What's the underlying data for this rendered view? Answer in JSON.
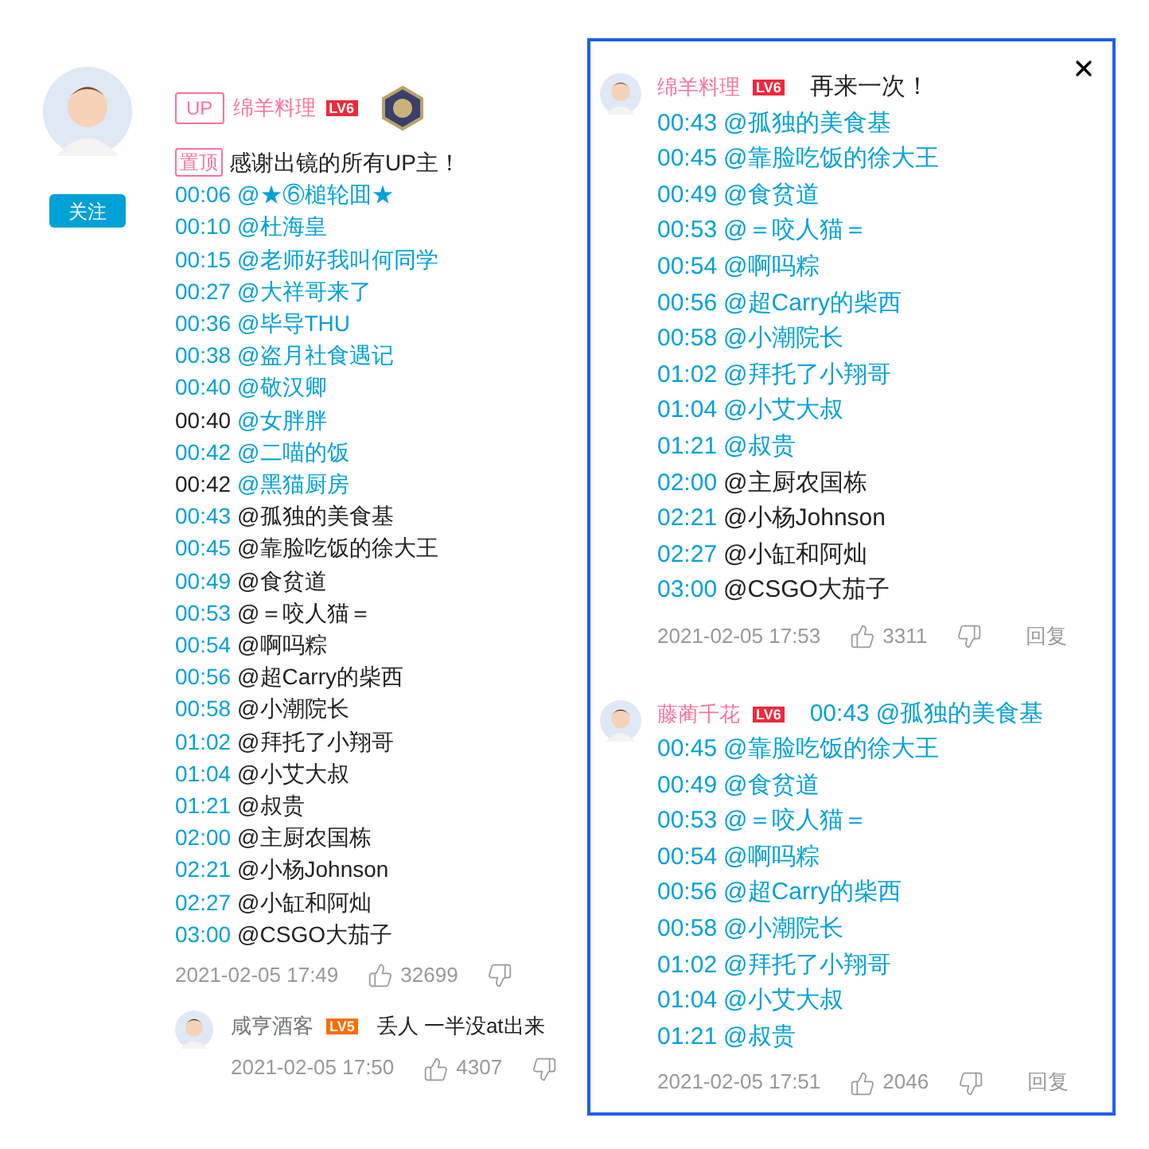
{
  "left_thread": {
    "follow_button": "关注",
    "comment": {
      "up_badge": "UP",
      "user": "绵羊料理",
      "level": {
        "label": "LV6",
        "color": "#f0283c"
      },
      "pinned_badge": "置顶",
      "text": "感谢出镜的所有UP主！",
      "lines": [
        {
          "time": "00:06",
          "mention": "@★⑥槌轮囬★",
          "time_link": true,
          "mention_link": true
        },
        {
          "time": "00:10",
          "mention": "@杜海皇",
          "time_link": true,
          "mention_link": true
        },
        {
          "time": "00:15",
          "mention": "@老师好我叫何同学",
          "time_link": true,
          "mention_link": true
        },
        {
          "time": "00:27",
          "mention": "@大祥哥来了",
          "time_link": true,
          "mention_link": true
        },
        {
          "time": "00:36",
          "mention": "@毕导THU",
          "time_link": true,
          "mention_link": true
        },
        {
          "time": "00:38",
          "mention": "@盗月社食遇记",
          "time_link": true,
          "mention_link": true
        },
        {
          "time": "00:40",
          "mention": "@敬汉卿",
          "time_link": true,
          "mention_link": true
        },
        {
          "time": "00:40",
          "mention": "@女胖胖",
          "time_link": false,
          "mention_link": true
        },
        {
          "time": "00:42",
          "mention": "@二喵的饭",
          "time_link": true,
          "mention_link": true
        },
        {
          "time": "00:42",
          "mention": "@黑猫厨房",
          "time_link": false,
          "mention_link": true
        },
        {
          "time": "00:43",
          "mention": "@孤独的美食基",
          "time_link": true,
          "mention_link": false
        },
        {
          "time": "00:45",
          "mention": "@靠脸吃饭的徐大王",
          "time_link": true,
          "mention_link": false
        },
        {
          "time": "00:49",
          "mention": "@食贫道",
          "time_link": true,
          "mention_link": false
        },
        {
          "time": "00:53",
          "mention": "@＝咬人猫＝",
          "time_link": true,
          "mention_link": false
        },
        {
          "time": "00:54",
          "mention": "@啊吗粽",
          "time_link": true,
          "mention_link": false
        },
        {
          "time": "00:56",
          "mention": "@超Carry的柴西",
          "time_link": true,
          "mention_link": false
        },
        {
          "time": "00:58",
          "mention": "@小潮院长",
          "time_link": true,
          "mention_link": false
        },
        {
          "time": "01:02",
          "mention": "@拜托了小翔哥",
          "time_link": true,
          "mention_link": false
        },
        {
          "time": "01:04",
          "mention": "@小艾大叔",
          "time_link": true,
          "mention_link": false
        },
        {
          "time": "01:21",
          "mention": "@叔贵",
          "time_link": true,
          "mention_link": false
        },
        {
          "time": "02:00",
          "mention": "@主厨农国栋",
          "time_link": true,
          "mention_link": false
        },
        {
          "time": "02:21",
          "mention": "@小杨Johnson",
          "time_link": true,
          "mention_link": false
        },
        {
          "time": "02:27",
          "mention": "@小缸和阿灿",
          "time_link": true,
          "mention_link": false
        },
        {
          "time": "03:00",
          "mention": "@CSGO大茄子",
          "time_link": true,
          "mention_link": false
        }
      ],
      "date": "2021-02-05 17:49",
      "likes": "32699"
    },
    "reply": {
      "user": "咸亨酒客",
      "level": {
        "label": "LV5",
        "color": "#ff6c00"
      },
      "text": "丢人 一半没at出来",
      "date": "2021-02-05 17:50",
      "likes": "4307"
    }
  },
  "dialog": {
    "comments": [
      {
        "user": "绵羊料理",
        "level": {
          "label": "LV6",
          "color": "#f0283c"
        },
        "text": "再来一次！",
        "lines": [
          {
            "time": "00:43",
            "mention": "@孤独的美食基",
            "time_link": true,
            "mention_link": true
          },
          {
            "time": "00:45",
            "mention": "@靠脸吃饭的徐大王",
            "time_link": true,
            "mention_link": true
          },
          {
            "time": "00:49",
            "mention": "@食贫道",
            "time_link": true,
            "mention_link": true
          },
          {
            "time": "00:53",
            "mention": "@＝咬人猫＝",
            "time_link": true,
            "mention_link": true
          },
          {
            "time": "00:54",
            "mention": "@啊吗粽",
            "time_link": true,
            "mention_link": true
          },
          {
            "time": "00:56",
            "mention": "@超Carry的柴西",
            "time_link": true,
            "mention_link": true
          },
          {
            "time": "00:58",
            "mention": "@小潮院长",
            "time_link": true,
            "mention_link": true
          },
          {
            "time": "01:02",
            "mention": "@拜托了小翔哥",
            "time_link": true,
            "mention_link": true
          },
          {
            "time": "01:04",
            "mention": "@小艾大叔",
            "time_link": true,
            "mention_link": true
          },
          {
            "time": "01:21",
            "mention": "@叔贵",
            "time_link": true,
            "mention_link": true
          },
          {
            "time": "02:00",
            "mention": "@主厨农国栋",
            "time_link": true,
            "mention_link": false
          },
          {
            "time": "02:21",
            "mention": "@小杨Johnson",
            "time_link": true,
            "mention_link": false
          },
          {
            "time": "02:27",
            "mention": "@小缸和阿灿",
            "time_link": true,
            "mention_link": false
          },
          {
            "time": "03:00",
            "mention": "@CSGO大茄子",
            "time_link": true,
            "mention_link": false
          }
        ],
        "date": "2021-02-05 17:53",
        "likes": "3311",
        "reply_label": "回复"
      },
      {
        "user": "藤蔺千花",
        "level": {
          "label": "LV6",
          "color": "#f0283c"
        },
        "lines": [
          {
            "time": "00:43",
            "mention": "@孤独的美食基",
            "time_link": true,
            "mention_link": true
          },
          {
            "time": "00:45",
            "mention": "@靠脸吃饭的徐大王",
            "time_link": true,
            "mention_link": true
          },
          {
            "time": "00:49",
            "mention": "@食贫道",
            "time_link": true,
            "mention_link": true
          },
          {
            "time": "00:53",
            "mention": "@＝咬人猫＝",
            "time_link": true,
            "mention_link": true
          },
          {
            "time": "00:54",
            "mention": "@啊吗粽",
            "time_link": true,
            "mention_link": true
          },
          {
            "time": "00:56",
            "mention": "@超Carry的柴西",
            "time_link": true,
            "mention_link": true
          },
          {
            "time": "00:58",
            "mention": "@小潮院长",
            "time_link": true,
            "mention_link": true
          },
          {
            "time": "01:02",
            "mention": "@拜托了小翔哥",
            "time_link": true,
            "mention_link": true
          },
          {
            "time": "01:04",
            "mention": "@小艾大叔",
            "time_link": true,
            "mention_link": true
          },
          {
            "time": "01:21",
            "mention": "@叔贵",
            "time_link": true,
            "mention_link": true
          }
        ],
        "date": "2021-02-05 17:51",
        "likes": "2046",
        "reply_label": "回复"
      }
    ]
  }
}
